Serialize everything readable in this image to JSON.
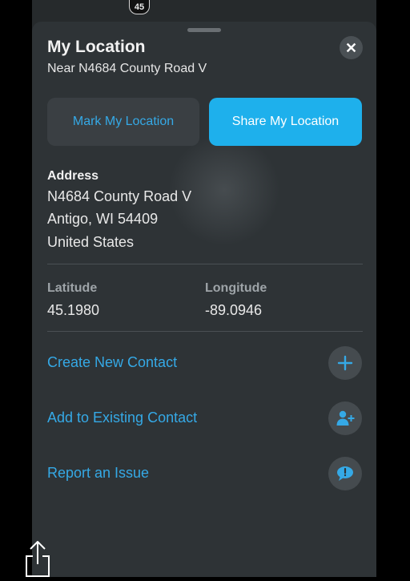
{
  "map": {
    "road_shield": "45"
  },
  "sheet": {
    "title": "My Location",
    "subtitle": "Near N4684 County Road V",
    "buttons": {
      "mark": "Mark My Location",
      "share": "Share My Location"
    },
    "address": {
      "label": "Address",
      "line1": "N4684 County Road V",
      "line2": "Antigo, WI  54409",
      "line3": "United States"
    },
    "coordinates": {
      "latitude_label": "Latitude",
      "latitude": "45.1980",
      "longitude_label": "Longitude",
      "longitude": "-89.0946"
    },
    "actions": [
      {
        "label": "Create New Contact",
        "icon": "plus-icon"
      },
      {
        "label": "Add to Existing Contact",
        "icon": "add-person-icon"
      },
      {
        "label": "Report an Issue",
        "icon": "speech-bubble-icon"
      }
    ]
  },
  "colors": {
    "accent": "#35a9e6",
    "share_button": "#1eb0ec",
    "sheet_background": "#2e3336"
  }
}
